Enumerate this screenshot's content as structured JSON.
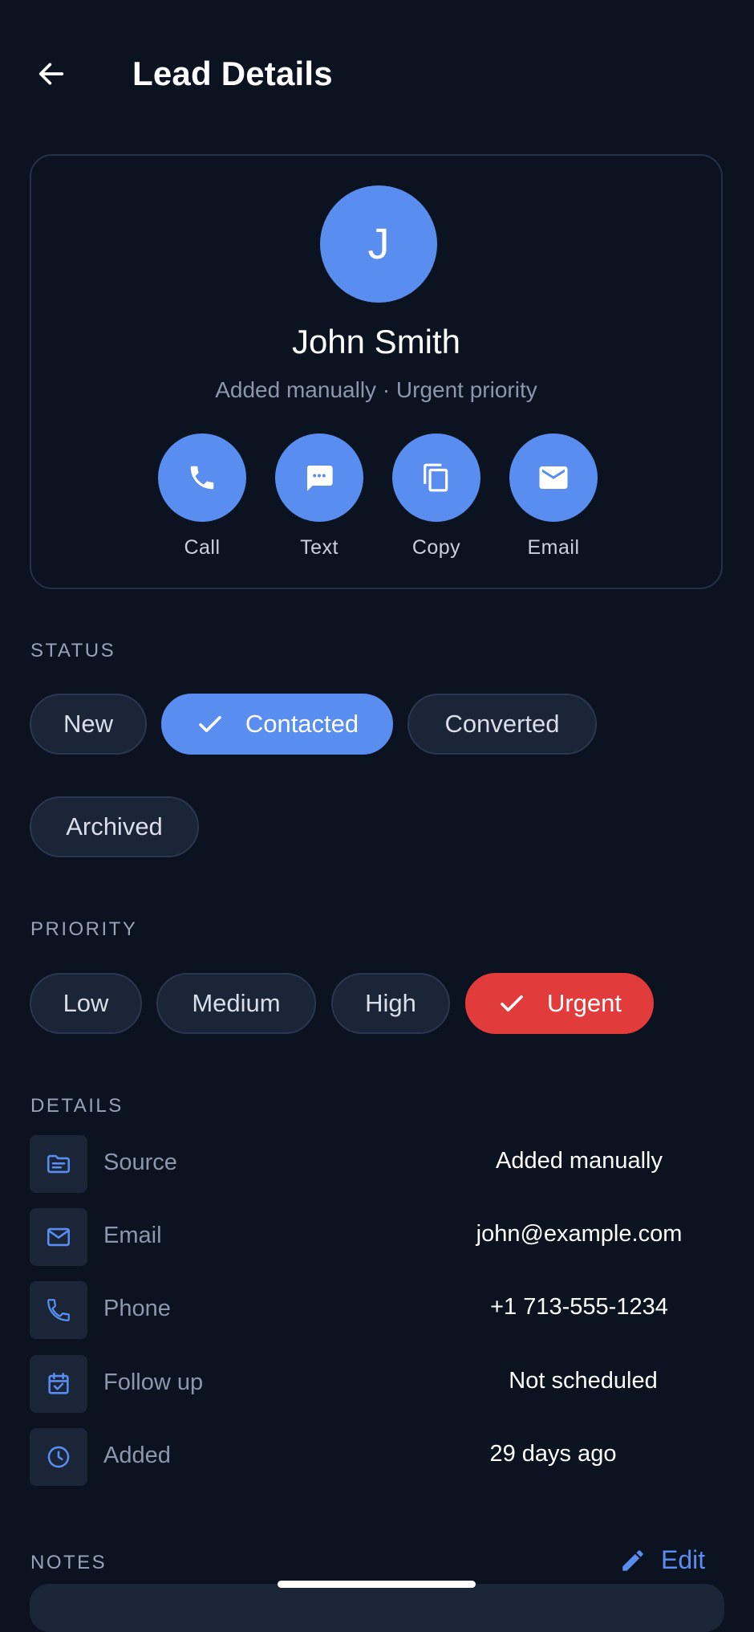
{
  "header": {
    "title": "Lead Details",
    "back_icon": "arrow-left-icon"
  },
  "profile": {
    "initial": "J",
    "name": "John Smith",
    "subtitle": "Added manually · Urgent priority",
    "actions": [
      {
        "label": "Call",
        "icon": "phone-icon"
      },
      {
        "label": "Text",
        "icon": "message-icon"
      },
      {
        "label": "Copy",
        "icon": "copy-icon"
      },
      {
        "label": "Email",
        "icon": "mail-icon"
      }
    ]
  },
  "status": {
    "title": "STATUS",
    "options": [
      "New",
      "Contacted",
      "Converted",
      "Archived"
    ],
    "selected": "Contacted"
  },
  "priority": {
    "title": "PRIORITY",
    "options": [
      "Low",
      "Medium",
      "High",
      "Urgent"
    ],
    "selected": "Urgent"
  },
  "details": {
    "title": "DETAILS",
    "rows": [
      {
        "label": "Source",
        "value": "Added manually",
        "icon": "source-icon"
      },
      {
        "label": "Email",
        "value": "john@example.com",
        "icon": "mail-icon"
      },
      {
        "label": "Phone",
        "value": "+1 713-555-1234",
        "icon": "phone-icon"
      },
      {
        "label": "Follow up",
        "value": "Not scheduled",
        "icon": "calendar-check-icon"
      },
      {
        "label": "Added",
        "value": "29 days ago",
        "icon": "clock-icon"
      }
    ]
  },
  "notes": {
    "title": "NOTES",
    "edit_label": "Edit",
    "edit_icon": "pencil-icon"
  },
  "colors": {
    "background": "#0b1220",
    "accent": "#5a8df0",
    "urgent": "#e23b3b",
    "chip": "#1a2538"
  }
}
